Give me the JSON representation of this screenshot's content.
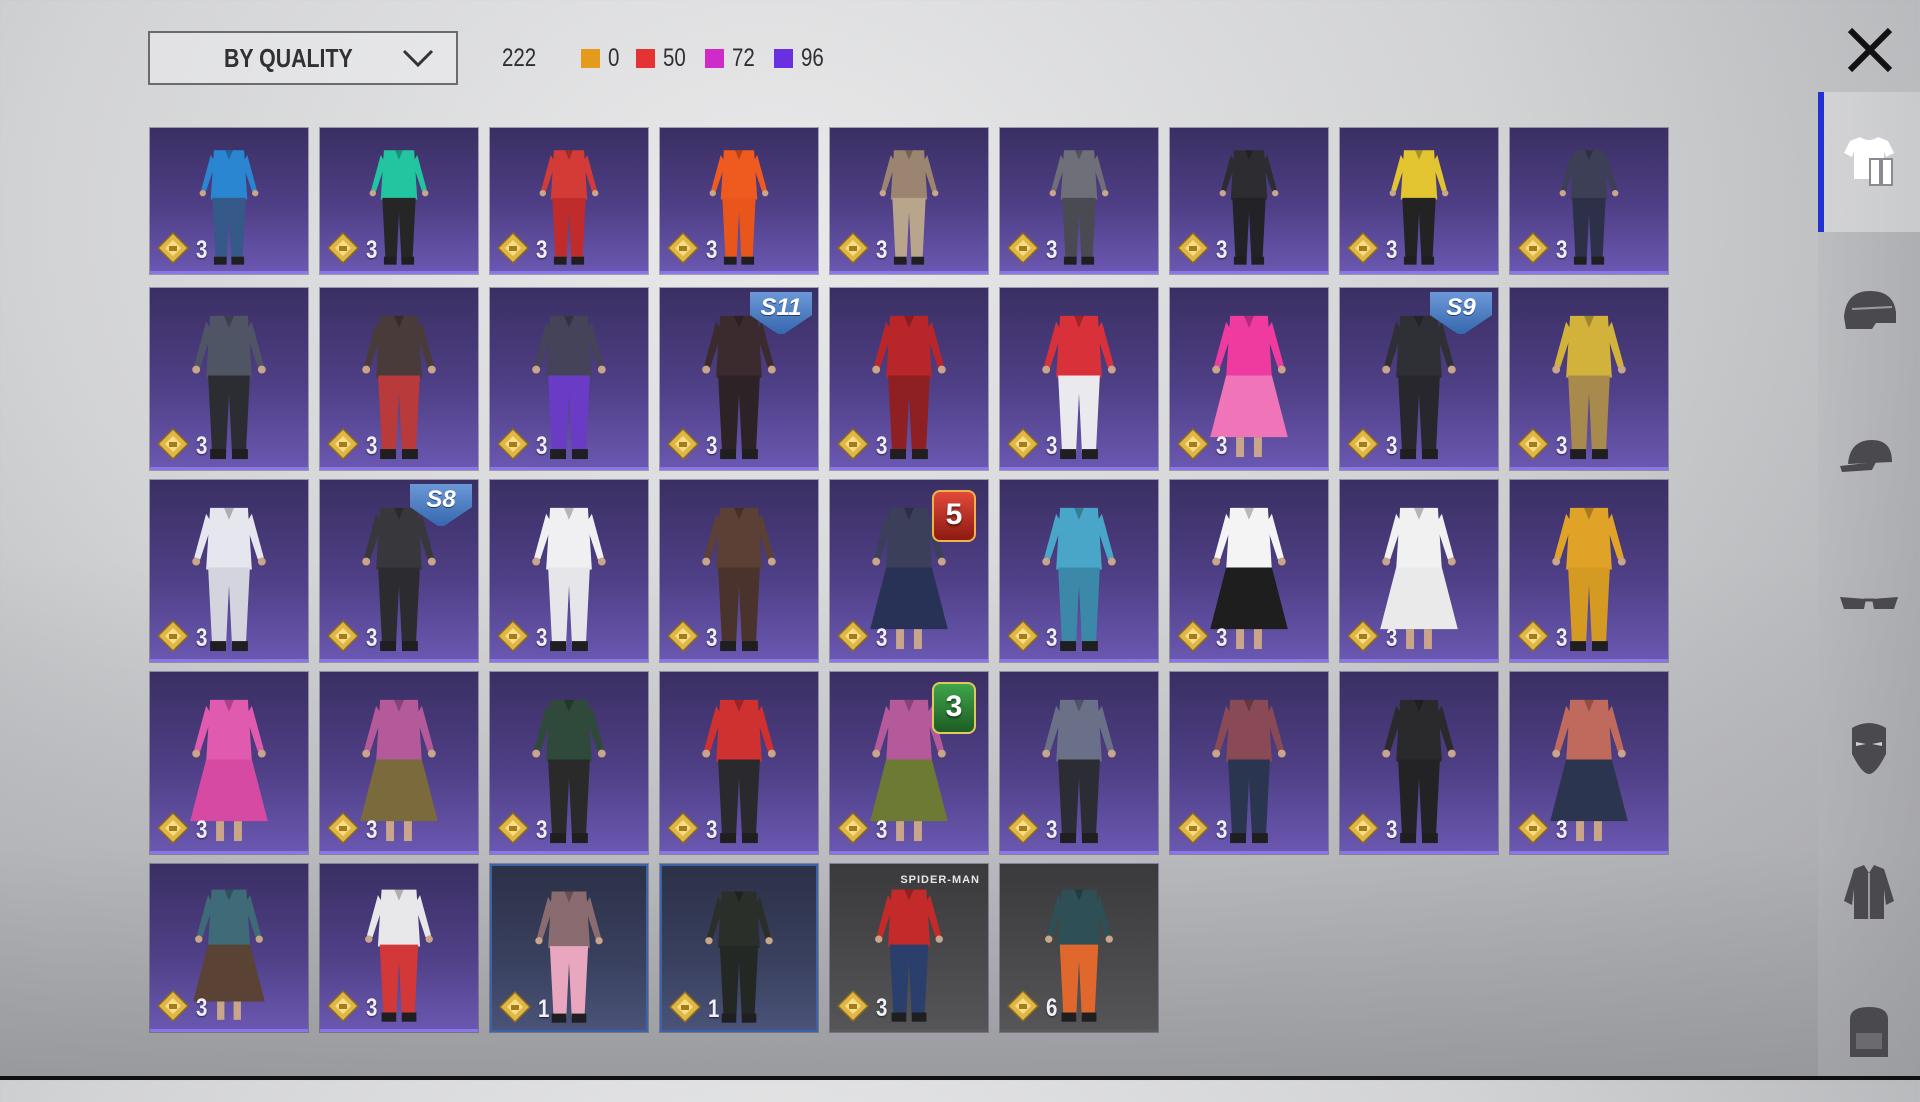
{
  "header": {
    "sort_label": "BY QUALITY",
    "total_count": "222",
    "stats": [
      {
        "color": "#e49a1b",
        "value": "0"
      },
      {
        "color": "#e53333",
        "value": "50"
      },
      {
        "color": "#cf2bc8",
        "value": "72"
      },
      {
        "color": "#6a2fe0",
        "value": "96"
      }
    ]
  },
  "sidebar": {
    "items": [
      {
        "icon": "outfit-icon",
        "active": true
      },
      {
        "icon": "helmet-icon",
        "active": false
      },
      {
        "icon": "cap-icon",
        "active": false
      },
      {
        "icon": "glasses-icon",
        "active": false
      },
      {
        "icon": "mask-icon",
        "active": false
      },
      {
        "icon": "jacket-icon",
        "active": false
      },
      {
        "icon": "backpack-icon",
        "active": false
      }
    ]
  },
  "grid": {
    "items": [
      {
        "qty": "3",
        "style": "purple",
        "top": "#2a86d1",
        "bottom": "#355a8a"
      },
      {
        "qty": "3",
        "style": "purple",
        "top": "#22c5a0",
        "bottom": "#262626"
      },
      {
        "qty": "3",
        "style": "purple",
        "top": "#d23b36",
        "bottom": "#c02c2c"
      },
      {
        "qty": "3",
        "style": "purple",
        "top": "#ef5a1f",
        "bottom": "#e8561c"
      },
      {
        "qty": "3",
        "style": "purple",
        "top": "#9b8470",
        "bottom": "#b8a58c"
      },
      {
        "qty": "3",
        "style": "purple",
        "top": "#6e6f78",
        "bottom": "#4a4b52"
      },
      {
        "qty": "3",
        "style": "purple",
        "top": "#2c2c31",
        "bottom": "#232327"
      },
      {
        "qty": "3",
        "style": "purple",
        "top": "#e2c530",
        "bottom": "#232323"
      },
      {
        "qty": "3",
        "style": "purple",
        "top": "#3c3f55",
        "bottom": "#2c3049"
      },
      {
        "qty": "3",
        "style": "purple",
        "top": "#505566",
        "bottom": "#2c2d33"
      },
      {
        "qty": "3",
        "style": "purple",
        "top": "#4a3b3b",
        "bottom": "#b83a3a"
      },
      {
        "qty": "3",
        "style": "purple",
        "top": "#45435a",
        "bottom": "#6a3cc6"
      },
      {
        "qty": "3",
        "style": "purple",
        "top": "#3b2b2e",
        "bottom": "#2d2226",
        "season": "S11"
      },
      {
        "qty": "3",
        "style": "purple",
        "top": "#b8262a",
        "bottom": "#8e1f22"
      },
      {
        "qty": "3",
        "style": "purple",
        "top": "#d9313a",
        "bottom": "#e9e9ee"
      },
      {
        "qty": "3",
        "style": "purple",
        "top": "#ef3aa0",
        "bottom": "#f074b8",
        "dress": true
      },
      {
        "qty": "3",
        "style": "purple",
        "top": "#2f2f36",
        "bottom": "#27272d",
        "season": "S9"
      },
      {
        "qty": "3",
        "style": "purple",
        "top": "#d2b23a",
        "bottom": "#a78a4c"
      },
      {
        "qty": "3",
        "style": "purple",
        "top": "#e6e6ee",
        "bottom": "#d4d4de"
      },
      {
        "qty": "3",
        "style": "purple",
        "top": "#38383c",
        "bottom": "#2c2c30",
        "season": "S8"
      },
      {
        "qty": "3",
        "style": "purple",
        "top": "#f0f0f2",
        "bottom": "#e6e6ea"
      },
      {
        "qty": "3",
        "style": "purple",
        "top": "#5c4036",
        "bottom": "#4a332c"
      },
      {
        "qty": "3",
        "style": "purple",
        "top": "#3b3f5a",
        "bottom": "#273256",
        "tier": "5",
        "tier_color": "red",
        "dress": true
      },
      {
        "qty": "3",
        "style": "purple",
        "top": "#4aa6c9",
        "bottom": "#3c88a8"
      },
      {
        "qty": "3",
        "style": "purple",
        "top": "#f4f4f4",
        "bottom": "#1e1e1e",
        "dress": true
      },
      {
        "qty": "3",
        "style": "purple",
        "top": "#f1f1f1",
        "bottom": "#eaeaea",
        "dress": true
      },
      {
        "qty": "3",
        "style": "purple",
        "top": "#e0a328",
        "bottom": "#d49a22"
      },
      {
        "qty": "3",
        "style": "purple",
        "top": "#e05ab0",
        "bottom": "#d64aa4",
        "dress": true
      },
      {
        "qty": "3",
        "style": "purple",
        "top": "#b45a9a",
        "bottom": "#7b6a3c",
        "dress": true
      },
      {
        "qty": "3",
        "style": "purple",
        "top": "#2f4a3a",
        "bottom": "#2a2a2a"
      },
      {
        "qty": "3",
        "style": "purple",
        "top": "#cf3030",
        "bottom": "#2a2a2e"
      },
      {
        "qty": "3",
        "style": "purple",
        "top": "#b45a9a",
        "bottom": "#6d7a34",
        "tier": "3",
        "tier_color": "green",
        "dress": true
      },
      {
        "qty": "3",
        "style": "purple",
        "top": "#6a7087",
        "bottom": "#2c2c34"
      },
      {
        "qty": "3",
        "style": "purple",
        "top": "#8a4a55",
        "bottom": "#2a3550"
      },
      {
        "qty": "3",
        "style": "purple",
        "top": "#2a2a2c",
        "bottom": "#232325"
      },
      {
        "qty": "3",
        "style": "purple",
        "top": "#c06a5e",
        "bottom": "#2c3550",
        "dress": true
      },
      {
        "qty": "3",
        "style": "purple",
        "top": "#3f6b78",
        "bottom": "#5a4234",
        "dress": true
      },
      {
        "qty": "3",
        "style": "purple",
        "top": "#e8e8ea",
        "bottom": "#d33838"
      },
      {
        "qty": "1",
        "style": "blue",
        "top": "#8a6b6f",
        "bottom": "#e8a7bf"
      },
      {
        "qty": "1",
        "style": "blue",
        "top": "#2a2f2a",
        "bottom": "#242824"
      },
      {
        "qty": "3",
        "style": "grey",
        "top": "#c42a2a",
        "bottom": "#2b3f6d",
        "brand": "SPIDER-MAN"
      },
      {
        "qty": "6",
        "style": "grey",
        "top": "#2e4f55",
        "bottom": "#e0682c"
      }
    ]
  }
}
